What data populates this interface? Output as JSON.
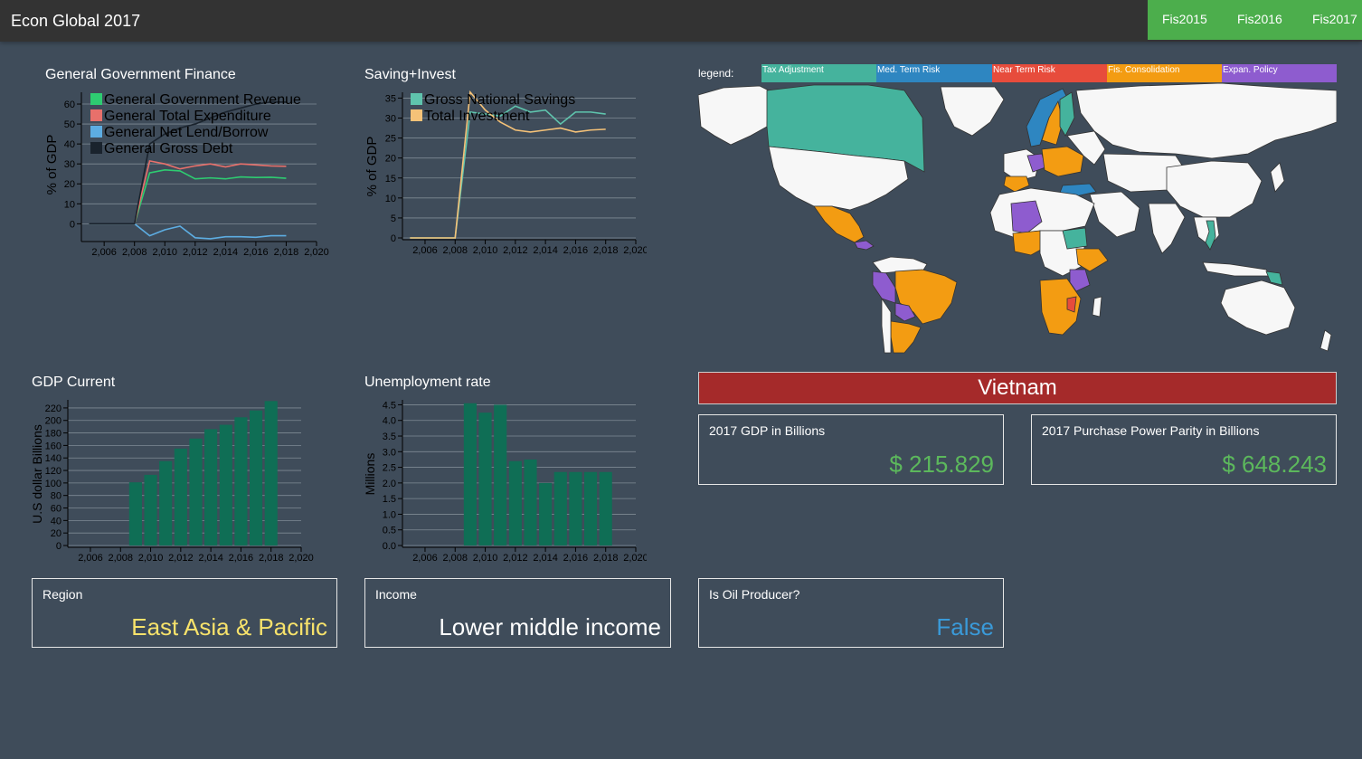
{
  "app": {
    "title": "Econ Global 2017",
    "nav": [
      "Fis2015",
      "Fis2016",
      "Fis2017"
    ]
  },
  "charts": {
    "finance": {
      "title": "General Government Finance",
      "ylabel": "% of GDP",
      "legend": [
        "General Government Revenue",
        "General Total Expenditure",
        "General Net Lend/Borrow",
        "General Gross Debt"
      ]
    },
    "saving": {
      "title": "Saving+Invest",
      "ylabel": "% of GDP",
      "legend": [
        "Gross National Savings",
        "Total Investment"
      ]
    },
    "gdp": {
      "title": "GDP Current",
      "ylabel": "U.S dollar Billions"
    },
    "unemp": {
      "title": "Unemployment rate",
      "ylabel": "Millions"
    }
  },
  "chart_data": [
    {
      "type": "line",
      "title": "General Government Finance",
      "ylabel": "% of GDP",
      "xlim": [
        2004.5,
        2020
      ],
      "ylim": [
        -8,
        65
      ],
      "x_ticks": [
        "2,006",
        "2,008",
        "2,010",
        "2,012",
        "2,014",
        "2,016",
        "2,018",
        "2,020"
      ],
      "y_ticks": [
        "0",
        "10",
        "20",
        "30",
        "40",
        "50",
        "60"
      ],
      "x": [
        2005,
        2006,
        2007,
        2008,
        2009,
        2010,
        2011,
        2012,
        2013,
        2014,
        2015,
        2016,
        2017,
        2018
      ],
      "series": [
        {
          "name": "General Government Revenue",
          "color": "#2ecc71",
          "values": [
            0,
            0,
            0,
            0,
            25.5,
            27,
            26.5,
            22.5,
            23,
            22.5,
            23.5,
            23.2,
            23.3,
            22.8
          ]
        },
        {
          "name": "General Total Expenditure",
          "color": "#e8706b",
          "values": [
            0,
            0,
            0,
            0,
            31.5,
            30,
            27.5,
            29,
            30,
            28.5,
            30,
            29.5,
            29,
            28.8
          ]
        },
        {
          "name": "General Net Lend/Borrow",
          "color": "#5dade2",
          "values": [
            0,
            0,
            0,
            0,
            -6,
            -3,
            -1.2,
            -7,
            -7.5,
            -6.5,
            -6.5,
            -6.8,
            -6,
            -6
          ]
        },
        {
          "name": "General Gross Debt",
          "color": "#1a232d",
          "values": [
            0,
            0,
            0,
            0,
            40,
            45,
            48,
            50,
            53,
            56,
            58,
            60,
            61,
            61
          ]
        }
      ]
    },
    {
      "type": "line",
      "title": "Saving+Invest",
      "ylabel": "% of GDP",
      "xlim": [
        2004.5,
        2020
      ],
      "ylim": [
        0,
        36
      ],
      "x_ticks": [
        "2,006",
        "2,008",
        "2,010",
        "2,012",
        "2,014",
        "2,016",
        "2,018",
        "2,020"
      ],
      "y_ticks": [
        "0",
        "5",
        "10",
        "15",
        "20",
        "25",
        "30",
        "35"
      ],
      "x": [
        2005,
        2006,
        2007,
        2008,
        2009,
        2010,
        2011,
        2012,
        2013,
        2014,
        2015,
        2016,
        2017,
        2018
      ],
      "series": [
        {
          "name": "Gross National Savings",
          "color": "#5fc4ad",
          "values": [
            0,
            0,
            0,
            0,
            31.5,
            31,
            30.5,
            33,
            31.5,
            32,
            28.5,
            31.5,
            31.5,
            31
          ]
        },
        {
          "name": "Total Investment",
          "color": "#f5c278",
          "values": [
            0,
            0,
            0,
            0,
            36.5,
            32,
            29,
            27,
            26.5,
            27,
            27.5,
            26.5,
            27,
            27.2
          ]
        }
      ]
    },
    {
      "type": "bar",
      "title": "GDP Current",
      "ylabel": "U.S dollar Billions",
      "xlim": [
        2004.5,
        2020
      ],
      "ylim": [
        0,
        230
      ],
      "x_ticks": [
        "2,006",
        "2,008",
        "2,010",
        "2,012",
        "2,014",
        "2,016",
        "2,018",
        "2,020"
      ],
      "y_ticks": [
        "0",
        "20",
        "40",
        "60",
        "80",
        "100",
        "120",
        "140",
        "160",
        "180",
        "200",
        "220"
      ],
      "x": [
        2009,
        2010,
        2011,
        2012,
        2013,
        2014,
        2015,
        2016,
        2017,
        2018
      ],
      "values": [
        101,
        113,
        135,
        155,
        171,
        186,
        193,
        205,
        216,
        231
      ],
      "color": "#0f6e55"
    },
    {
      "type": "bar",
      "title": "Unemployment rate",
      "ylabel": "Millions",
      "xlim": [
        2004.5,
        2020
      ],
      "ylim": [
        0,
        4.6
      ],
      "x_ticks": [
        "2,006",
        "2,008",
        "2,010",
        "2,012",
        "2,014",
        "2,016",
        "2,018",
        "2,020"
      ],
      "y_ticks": [
        "0.0",
        "0.5",
        "1.0",
        "1.5",
        "2.0",
        "2.5",
        "3.0",
        "3.5",
        "4.0",
        "4.5"
      ],
      "x": [
        2009,
        2010,
        2011,
        2012,
        2013,
        2014,
        2015,
        2016,
        2017,
        2018
      ],
      "values": [
        4.55,
        4.25,
        4.5,
        2.7,
        2.75,
        2.0,
        2.35,
        2.35,
        2.35,
        2.35
      ],
      "color": "#0f6e55"
    }
  ],
  "map": {
    "legend_label": "legend:",
    "legend": [
      {
        "label": "Tax Adjustment",
        "color": "#45b39d"
      },
      {
        "label": "Med. Term Risk",
        "color": "#2e86c1"
      },
      {
        "label": "Near Term Risk",
        "color": "#e74c3c"
      },
      {
        "label": "Fis. Consolidation",
        "color": "#f39c12"
      },
      {
        "label": "Expan. Policy",
        "color": "#8e5ccf"
      }
    ],
    "land_color": "#f7f7f7"
  },
  "country": {
    "name": "Vietnam",
    "gdp_label": "2017 GDP in Billions",
    "gdp_value": "$ 215.829",
    "ppp_label": "2017 Purchase Power Parity in Billions",
    "ppp_value": "$ 648.243",
    "region_label": "Region",
    "region_value": "East Asia & Pacific",
    "income_label": "Income",
    "income_value": "Lower middle income",
    "oil_label": "Is Oil Producer?",
    "oil_value": "False"
  }
}
